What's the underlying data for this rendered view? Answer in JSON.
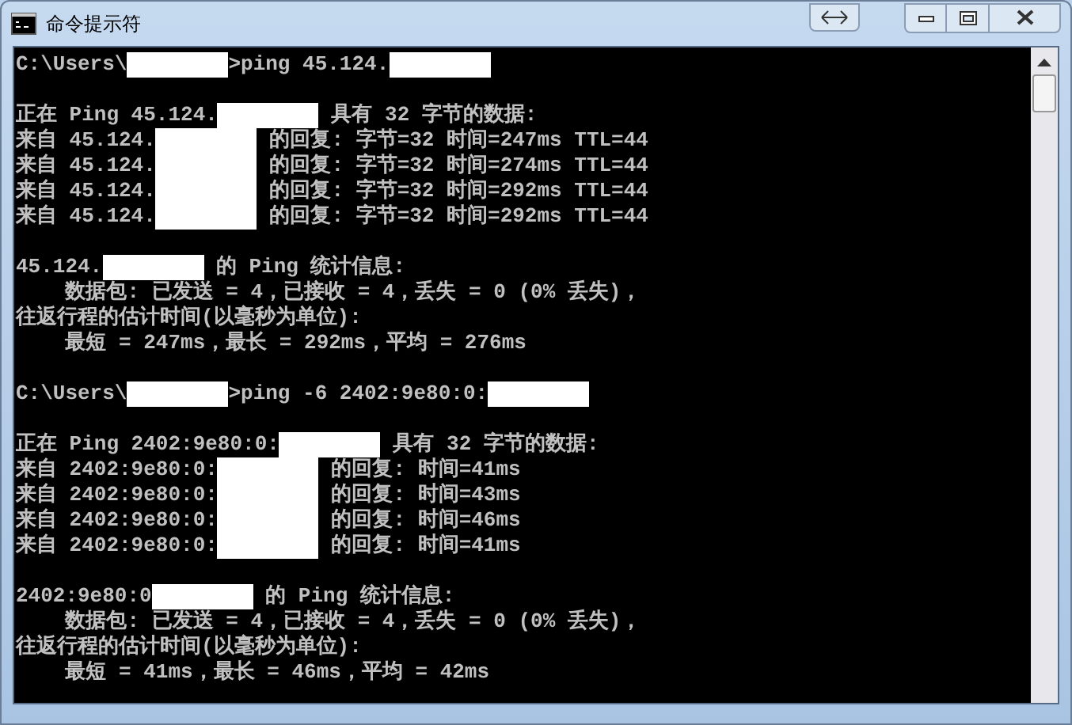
{
  "window": {
    "title": "命令提示符"
  },
  "console": {
    "lines": [
      {
        "kind": "text",
        "segments": [
          {
            "kind": "text",
            "text": "C:\\Users\\"
          },
          {
            "kind": "redaction"
          },
          {
            "kind": "text",
            "text": ">ping 45.124."
          },
          {
            "kind": "redaction"
          }
        ]
      },
      {
        "kind": "blank"
      },
      {
        "kind": "text",
        "segments": [
          {
            "kind": "text",
            "text": "正在 Ping 45.124."
          },
          {
            "kind": "redaction"
          },
          {
            "kind": "text",
            "text": " 具有 32 字节的数据:"
          }
        ]
      },
      {
        "kind": "text",
        "segments": [
          {
            "kind": "text",
            "text": "来自 45.124."
          },
          {
            "kind": "redaction"
          },
          {
            "kind": "text",
            "text": " 的回复: 字节=32 时间=247ms TTL=44"
          }
        ]
      },
      {
        "kind": "text",
        "segments": [
          {
            "kind": "text",
            "text": "来自 45.124."
          },
          {
            "kind": "redaction"
          },
          {
            "kind": "text",
            "text": " 的回复: 字节=32 时间=274ms TTL=44"
          }
        ]
      },
      {
        "kind": "text",
        "segments": [
          {
            "kind": "text",
            "text": "来自 45.124."
          },
          {
            "kind": "redaction"
          },
          {
            "kind": "text",
            "text": " 的回复: 字节=32 时间=292ms TTL=44"
          }
        ]
      },
      {
        "kind": "text",
        "segments": [
          {
            "kind": "text",
            "text": "来自 45.124."
          },
          {
            "kind": "redaction"
          },
          {
            "kind": "text",
            "text": " 的回复: 字节=32 时间=292ms TTL=44"
          }
        ]
      },
      {
        "kind": "blank"
      },
      {
        "kind": "text",
        "segments": [
          {
            "kind": "text",
            "text": "45.124."
          },
          {
            "kind": "redaction"
          },
          {
            "kind": "text",
            "text": " 的 Ping 统计信息:"
          }
        ]
      },
      {
        "kind": "text",
        "segments": [
          {
            "kind": "text",
            "text": "    数据包: 已发送 = 4，已接收 = 4，丢失 = 0 (0% 丢失)，"
          }
        ]
      },
      {
        "kind": "text",
        "segments": [
          {
            "kind": "text",
            "text": "往返行程的估计时间(以毫秒为单位):"
          }
        ]
      },
      {
        "kind": "text",
        "segments": [
          {
            "kind": "text",
            "text": "    最短 = 247ms，最长 = 292ms，平均 = 276ms"
          }
        ]
      },
      {
        "kind": "blank"
      },
      {
        "kind": "text",
        "segments": [
          {
            "kind": "text",
            "text": "C:\\Users\\"
          },
          {
            "kind": "redaction"
          },
          {
            "kind": "text",
            "text": ">ping -6 2402:9e80:0:"
          },
          {
            "kind": "redaction"
          }
        ]
      },
      {
        "kind": "blank"
      },
      {
        "kind": "text",
        "segments": [
          {
            "kind": "text",
            "text": "正在 Ping 2402:9e80:0:"
          },
          {
            "kind": "redaction"
          },
          {
            "kind": "text",
            "text": " 具有 32 字节的数据:"
          }
        ]
      },
      {
        "kind": "text",
        "segments": [
          {
            "kind": "text",
            "text": "来自 2402:9e80:0:"
          },
          {
            "kind": "redaction"
          },
          {
            "kind": "text",
            "text": " 的回复: 时间=41ms"
          }
        ]
      },
      {
        "kind": "text",
        "segments": [
          {
            "kind": "text",
            "text": "来自 2402:9e80:0:"
          },
          {
            "kind": "redaction"
          },
          {
            "kind": "text",
            "text": " 的回复: 时间=43ms"
          }
        ]
      },
      {
        "kind": "text",
        "segments": [
          {
            "kind": "text",
            "text": "来自 2402:9e80:0:"
          },
          {
            "kind": "redaction"
          },
          {
            "kind": "text",
            "text": " 的回复: 时间=46ms"
          }
        ]
      },
      {
        "kind": "text",
        "segments": [
          {
            "kind": "text",
            "text": "来自 2402:9e80:0:"
          },
          {
            "kind": "redaction"
          },
          {
            "kind": "text",
            "text": " 的回复: 时间=41ms"
          }
        ]
      },
      {
        "kind": "blank"
      },
      {
        "kind": "text",
        "segments": [
          {
            "kind": "text",
            "text": "2402:9e80:0"
          },
          {
            "kind": "redaction"
          },
          {
            "kind": "text",
            "text": " 的 Ping 统计信息:"
          }
        ]
      },
      {
        "kind": "text",
        "segments": [
          {
            "kind": "text",
            "text": "    数据包: 已发送 = 4，已接收 = 4，丢失 = 0 (0% 丢失)，"
          }
        ]
      },
      {
        "kind": "text",
        "segments": [
          {
            "kind": "text",
            "text": "往返行程的估计时间(以毫秒为单位):"
          }
        ]
      },
      {
        "kind": "text",
        "segments": [
          {
            "kind": "text",
            "text": "    最短 = 41ms，最长 = 46ms，平均 = 42ms"
          }
        ]
      }
    ]
  }
}
